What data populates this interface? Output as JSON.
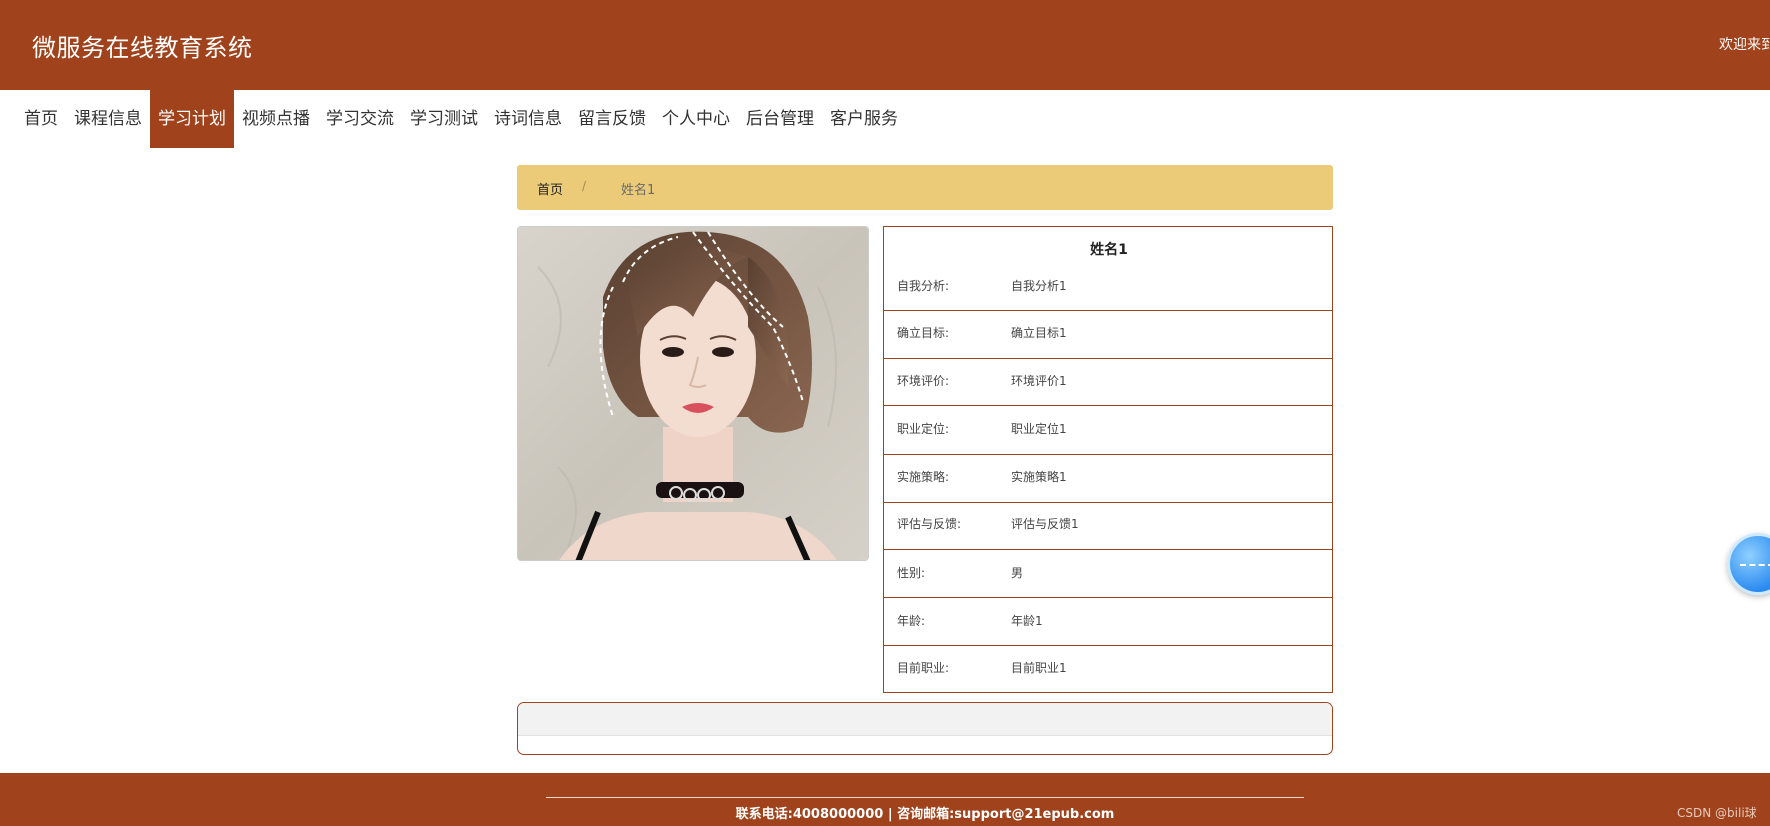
{
  "header": {
    "site_title": "微服务在线教育系统",
    "welcome_text": "欢迎来到"
  },
  "nav": {
    "items": [
      {
        "label": "首页",
        "active": false
      },
      {
        "label": "课程信息",
        "active": false
      },
      {
        "label": "学习计划",
        "active": true
      },
      {
        "label": "视频点播",
        "active": false
      },
      {
        "label": "学习交流",
        "active": false
      },
      {
        "label": "学习测试",
        "active": false
      },
      {
        "label": "诗词信息",
        "active": false
      },
      {
        "label": "留言反馈",
        "active": false
      },
      {
        "label": "个人中心",
        "active": false
      },
      {
        "label": "后台管理",
        "active": false
      },
      {
        "label": "客户服务",
        "active": false
      }
    ]
  },
  "breadcrumb": {
    "home": "首页",
    "separator": "/",
    "current": "姓名1"
  },
  "details": {
    "title": "姓名1",
    "rows": [
      {
        "label": "自我分析:",
        "value": "自我分析1"
      },
      {
        "label": "确立目标:",
        "value": "确立目标1"
      },
      {
        "label": "环境评价:",
        "value": "环境评价1"
      },
      {
        "label": "职业定位:",
        "value": "职业定位1"
      },
      {
        "label": "实施策略:",
        "value": "实施策略1"
      },
      {
        "label": "评估与反馈:",
        "value": "评估与反馈1"
      },
      {
        "label": "性别:",
        "value": "男"
      },
      {
        "label": "年龄:",
        "value": "年龄1"
      },
      {
        "label": "目前职业:",
        "value": "目前职业1"
      }
    ]
  },
  "footer": {
    "contact": "联系电话:4008000000 | 咨询邮箱:support@21epub.com",
    "watermark": "CSDN @bili球"
  },
  "colors": {
    "brand": "#a0421c",
    "breadcrumb_bg": "#ebcb78"
  }
}
